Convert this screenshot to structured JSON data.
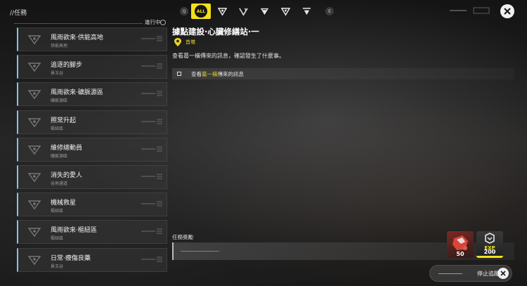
{
  "header": {
    "title": "//任務"
  },
  "filters": {
    "left_key": "Q",
    "right_key": "E",
    "tabs": [
      {
        "label": "ALL",
        "icon": "all-icon",
        "active": true
      },
      {
        "label": "",
        "icon": "main-quest-icon",
        "active": false
      },
      {
        "label": "",
        "icon": "branch-quest-icon",
        "active": false
      },
      {
        "label": "",
        "icon": "commission-icon",
        "active": false
      },
      {
        "label": "",
        "icon": "event-quest-icon",
        "active": false
      },
      {
        "label": "",
        "icon": "daily-quest-icon",
        "active": false
      }
    ]
  },
  "list": {
    "status_label": "進行中",
    "quests": [
      {
        "name": "風雨欲來·供能高地",
        "location": "供能高地"
      },
      {
        "name": "追逐的腳步",
        "location": "景玉谷"
      },
      {
        "name": "風雨欲來·礦脈源區",
        "location": "礦脈源區"
      },
      {
        "name": "照常升起",
        "location": "樞紐區"
      },
      {
        "name": "維修總動員",
        "location": "礦脈源區"
      },
      {
        "name": "消失的愛人",
        "location": "谷地通道"
      },
      {
        "name": "機械救星",
        "location": "樞紐區"
      },
      {
        "name": "風雨欲來·樞紐區",
        "location": "樞紐區"
      },
      {
        "name": "日常·療傷良藥",
        "location": "景玉谷"
      }
    ]
  },
  "detail": {
    "title": "據點建設·心臟修繕站·一",
    "location": "首墩",
    "description": "查看葛一橫傳來的訊息，確認發生了什麼事。",
    "objective_prefix": "查看",
    "objective_highlight": "葛一橫",
    "objective_suffix": "傳來的訊息"
  },
  "rewards": {
    "label": "任務獎勵",
    "items": [
      {
        "name": "material-reward",
        "amount": "50"
      },
      {
        "name": "exp-reward",
        "label": "EXP",
        "amount": "200"
      }
    ]
  },
  "footer": {
    "stop_track_label": "停止追蹤"
  },
  "colors": {
    "accent": "#f3df1b",
    "list_border": "#7fc7e6",
    "location_text": "#e7d32a"
  }
}
